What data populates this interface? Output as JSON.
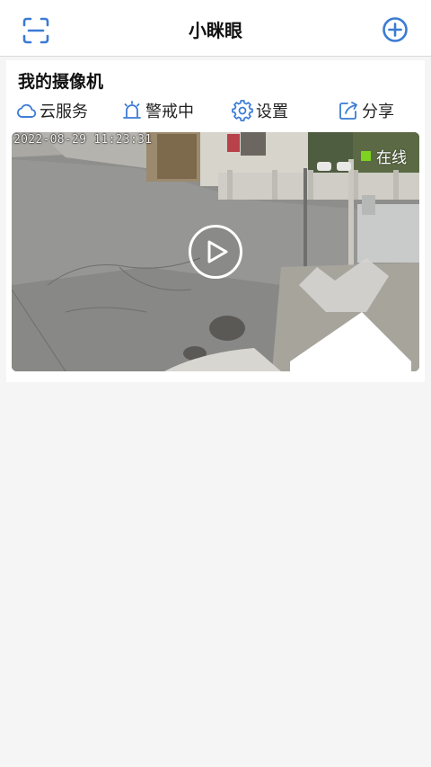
{
  "header": {
    "title": "小眯眼",
    "scan_icon": "scan-icon",
    "add_icon": "add-circle-icon"
  },
  "section": {
    "title": "我的摄像机"
  },
  "actions": [
    {
      "label": "云服务",
      "icon": "cloud-icon"
    },
    {
      "label": "警戒中",
      "icon": "alarm-bell-icon"
    },
    {
      "label": "设置",
      "icon": "gear-icon"
    },
    {
      "label": "分享",
      "icon": "share-icon"
    }
  ],
  "camera": {
    "timestamp": "2022-08-29 11:23:31",
    "status": "在线",
    "status_color": "#7ed321",
    "play_icon": "play-icon"
  },
  "colors": {
    "accent": "#3a7bd5",
    "background": "#f5f5f5"
  }
}
